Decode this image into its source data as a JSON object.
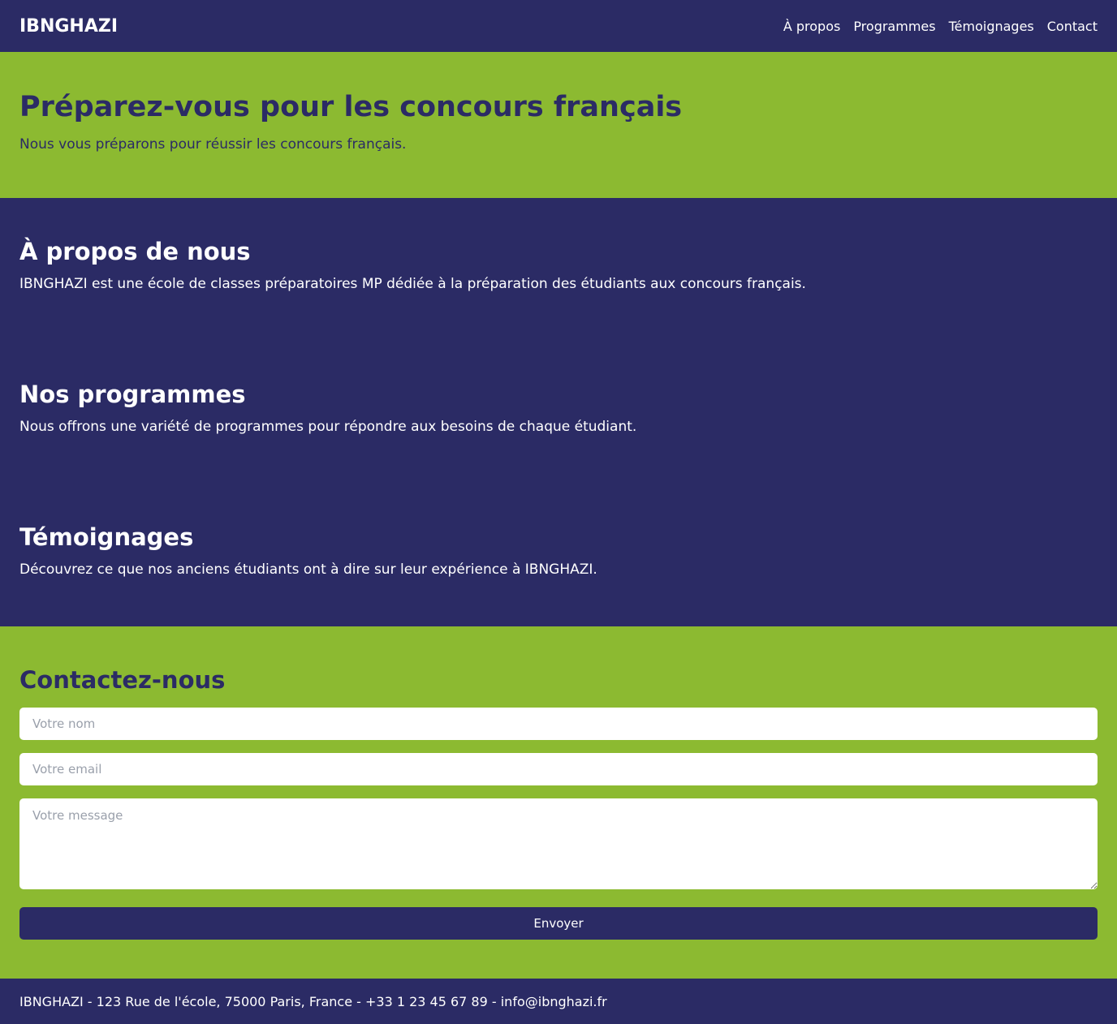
{
  "header": {
    "brand": "IBNGHAZI",
    "nav": [
      "À propos",
      "Programmes",
      "Témoignages",
      "Contact"
    ]
  },
  "hero": {
    "title": "Préparez-vous pour les concours français",
    "subtitle": "Nous vous préparons pour réussir les concours français."
  },
  "sections": [
    {
      "title": "À propos de nous",
      "text": "IBNGHAZI est une école de classes préparatoires MP dédiée à la préparation des étudiants aux concours français."
    },
    {
      "title": "Nos programmes",
      "text": "Nous offrons une variété de programmes pour répondre aux besoins de chaque étudiant."
    },
    {
      "title": "Témoignages",
      "text": "Découvrez ce que nos anciens étudiants ont à dire sur leur expérience à IBNGHAZI."
    }
  ],
  "contact": {
    "title": "Contactez-nous",
    "name_placeholder": "Votre nom",
    "email_placeholder": "Votre email",
    "message_placeholder": "Votre message",
    "submit_label": "Envoyer"
  },
  "footer": {
    "text": "IBNGHAZI - 123 Rue de l'école, 75000 Paris, France - +33 1 23 45 67 89 - info@ibnghazi.fr"
  },
  "colors": {
    "navy": "#2b2b65",
    "green": "#8cba31",
    "white": "#ffffff"
  }
}
